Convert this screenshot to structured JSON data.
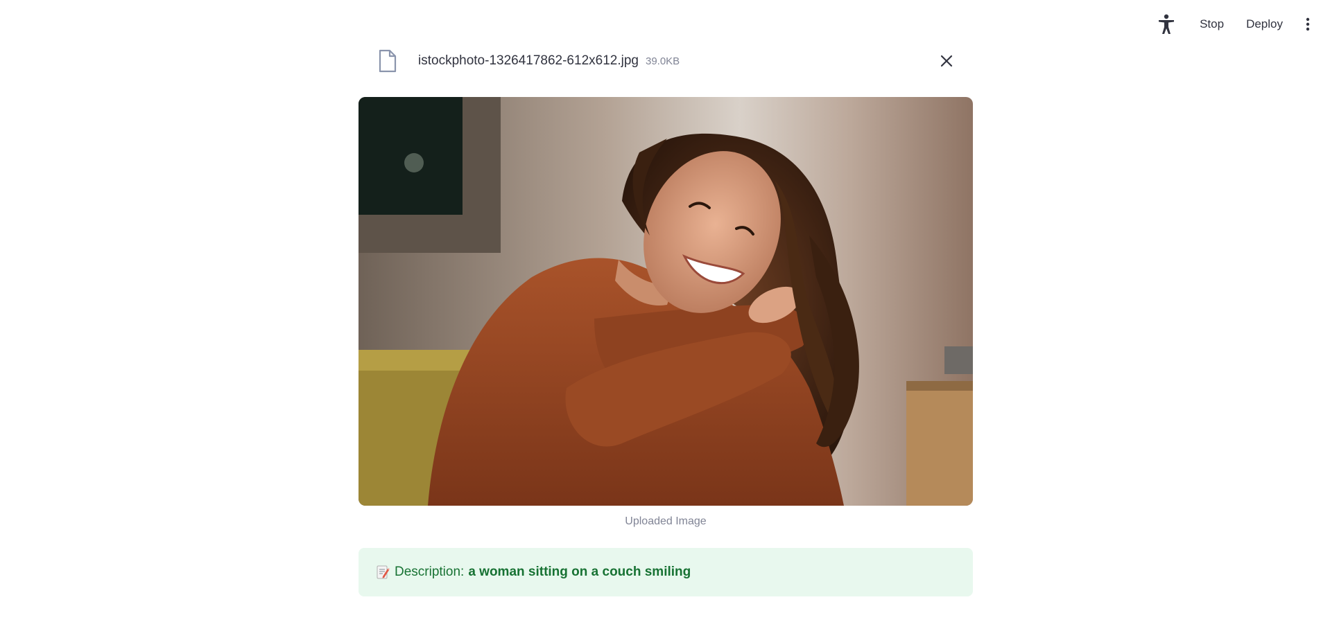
{
  "toolbar": {
    "accessibility_icon": "running-person-icon",
    "stop_label": "Stop",
    "deploy_label": "Deploy",
    "menu_icon": "vertical-ellipsis-icon"
  },
  "file": {
    "icon": "file-icon",
    "name": "istockphoto-1326417862-612x612.jpg",
    "size": "39.0KB",
    "close_icon": "close-icon"
  },
  "image": {
    "alt": "Uploaded Image",
    "caption": "Uploaded Image"
  },
  "description": {
    "emoji": "memo-icon",
    "label": "Description:",
    "text": "a woman sitting on a couch smiling",
    "colors": {
      "background": "#e8f8ee",
      "text": "#177233"
    }
  }
}
